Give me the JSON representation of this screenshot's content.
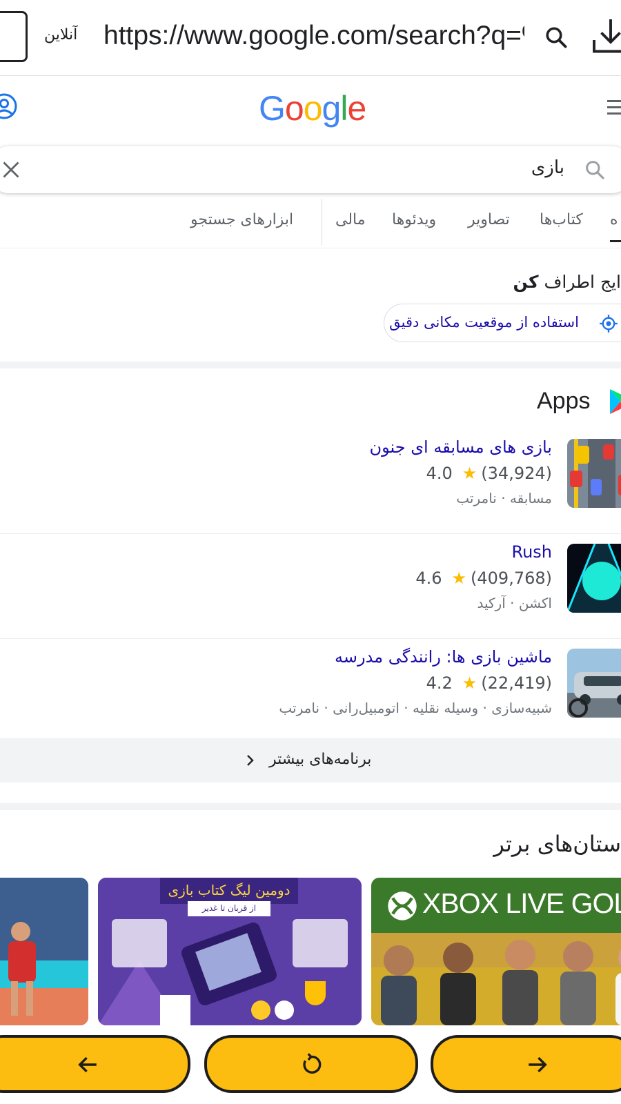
{
  "browser": {
    "online_label": "آنلاین",
    "url": "https://www.google.com/search?q=%"
  },
  "google": {
    "logo_letters": [
      "G",
      "o",
      "o",
      "g",
      "l",
      "e"
    ],
    "logo_colors": [
      "#4285F4",
      "#EA4335",
      "#FBBC05",
      "#4285F4",
      "#34A853",
      "#EA4335"
    ]
  },
  "search": {
    "query": "بازی"
  },
  "tabs": [
    {
      "label": "ه",
      "active": true
    },
    {
      "label": "کتاب‌ها"
    },
    {
      "label": "تصاویر"
    },
    {
      "label": "ویدئوها"
    },
    {
      "label": "مالی"
    },
    {
      "label": "ابزارهای جستجو"
    }
  ],
  "location": {
    "heading_prefix": "ایج اطراف",
    "heading_bold": "کن",
    "chip_label": "استفاده از موقعیت مکانی دقیق"
  },
  "apps": {
    "title": "Apps",
    "items": [
      {
        "name": "بازی های مسابقه ای جنون",
        "rating": "4.0",
        "reviews": "(34,924)",
        "meta": "مسابقه · نامرتب"
      },
      {
        "name": "Rush",
        "rating": "4.6",
        "reviews": "(409,768)",
        "meta": "اکشن · آرکید"
      },
      {
        "name": "ماشین بازی ها: رانندگی مدرسه",
        "rating": "4.2",
        "reviews": "(22,419)",
        "meta": "شبیه‌سازی · وسیله نقلیه · اتومبیل‌رانی · نامرتب"
      }
    ],
    "more_label": "برنامه‌های بیشتر"
  },
  "stories": {
    "heading": "ستان‌های برتر",
    "book_title": "دومین لیگ کتاب بازی",
    "book_subtitle": "از قربان تا غدیر",
    "xbox_label": "XBOX LIVE GOLD"
  },
  "colors": {
    "link": "#1a0dab",
    "star": "#fbbc04",
    "nav_button": "#fdbc10"
  }
}
